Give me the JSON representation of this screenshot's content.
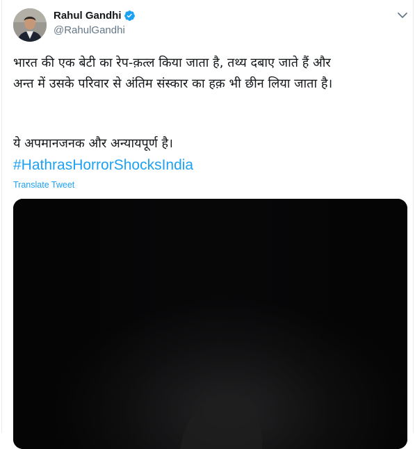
{
  "user": {
    "name": "Rahul Gandhi",
    "handle": "@RahulGandhi",
    "verified_icon": "verified-badge-icon",
    "accent_color": "#1da1f2"
  },
  "tweet": {
    "lines": [
      "भारत की एक बेटी का रेप-क़त्ल किया जाता है, तथ्य दबाए जाते हैं और",
      "अन्त में उसके परिवार से अंतिम संस्कार का हक़ भी छीन लिया जाता है।",
      "ये अपमानजनक और अन्यायपूर्ण है।"
    ],
    "hashtag": "#HathrasHorrorShocksIndia",
    "translate_label": "Translate Tweet"
  },
  "icons": {
    "menu": "chevron-down-icon"
  }
}
